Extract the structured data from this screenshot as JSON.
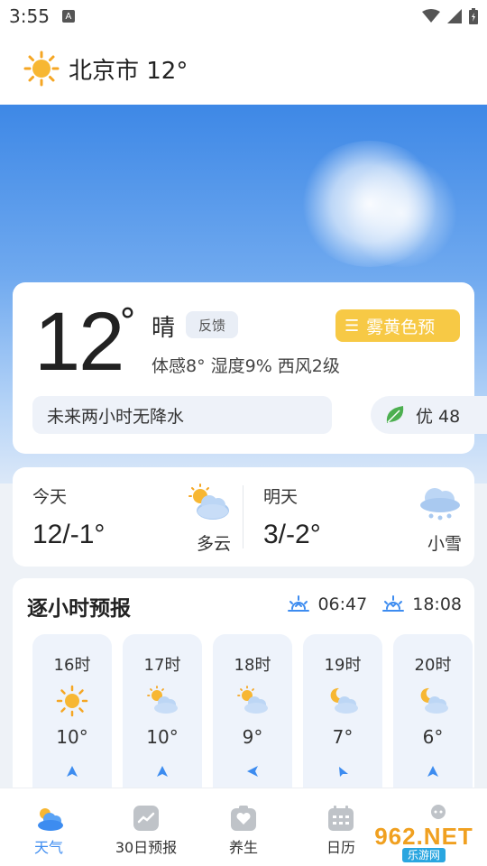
{
  "status_bar": {
    "time": "3:55",
    "notification_icon": "A"
  },
  "header": {
    "city_temp": "北京市 12°",
    "icon": "sun-icon"
  },
  "current": {
    "temperature": "12",
    "degree_symbol": "°",
    "condition": "晴",
    "feedback_label": "反馈",
    "alert_text": "雾黄色预",
    "alert_color": "#f7c945",
    "details": "体感8°  湿度9%  西风2级",
    "rain_forecast": "未来两小时无降水",
    "aqi_text": "优 48"
  },
  "days": [
    {
      "label": "今天",
      "range": "12/-1°",
      "desc": "多云",
      "icon": "partly-cloudy-icon"
    },
    {
      "label": "明天",
      "range": "3/-2°",
      "desc": "小雪",
      "icon": "light-snow-icon"
    }
  ],
  "hourly": {
    "title": "逐小时预报",
    "sunrise": "06:47",
    "sunset": "18:08",
    "items": [
      {
        "time": "16时",
        "temp": "10°",
        "icon": "sun-icon"
      },
      {
        "time": "17时",
        "temp": "10°",
        "icon": "partly-cloudy-icon"
      },
      {
        "time": "18时",
        "temp": "9°",
        "icon": "partly-cloudy-icon"
      },
      {
        "time": "19时",
        "temp": "7°",
        "icon": "night-cloudy-icon"
      },
      {
        "time": "20时",
        "temp": "6°",
        "icon": "night-cloudy-icon"
      }
    ]
  },
  "tabs": [
    {
      "label": "天气",
      "icon": "weather-icon",
      "active": true
    },
    {
      "label": "30日预报",
      "icon": "trend-icon",
      "active": false
    },
    {
      "label": "养生",
      "icon": "health-icon",
      "active": false
    },
    {
      "label": "日历",
      "icon": "calendar-icon",
      "active": false
    },
    {
      "label": "",
      "icon": "profile-icon",
      "active": false
    }
  ],
  "watermark": {
    "main": "962.NET",
    "sub": "乐游网"
  },
  "colors": {
    "accent": "#3d8cf0",
    "sky_top": "#3e88e6"
  }
}
